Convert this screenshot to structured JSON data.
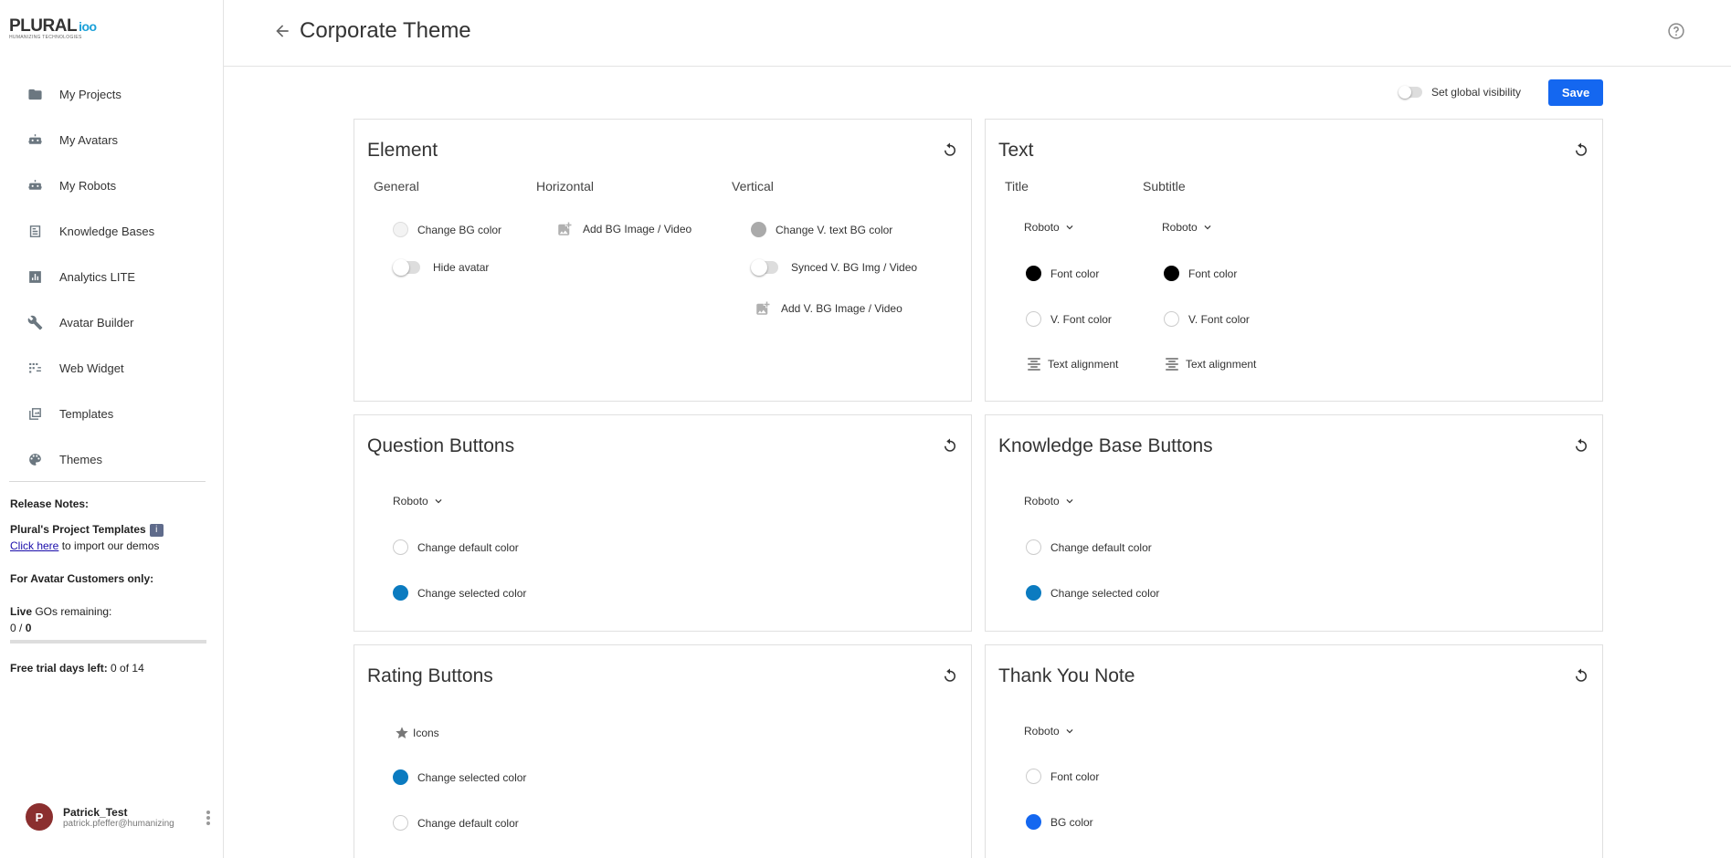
{
  "logo": {
    "word": "PLURAL",
    "mark": "ioo",
    "tagline": "HUMANIZING TECHNOLOGIES"
  },
  "nav": [
    {
      "label": "My Projects",
      "icon": "folder-icon"
    },
    {
      "label": "My Avatars",
      "icon": "robot-icon"
    },
    {
      "label": "My Robots",
      "icon": "robot-icon"
    },
    {
      "label": "Knowledge Bases",
      "icon": "book-icon"
    },
    {
      "label": "Analytics LITE",
      "icon": "chart-icon"
    },
    {
      "label": "Avatar Builder",
      "icon": "wrench-icon"
    },
    {
      "label": "Web Widget",
      "icon": "widget-icon"
    },
    {
      "label": "Templates",
      "icon": "templates-icon"
    },
    {
      "label": "Themes",
      "icon": "palette-icon"
    }
  ],
  "release": {
    "heading": "Release Notes:",
    "templates_title": "Plural's Project Templates",
    "info_glyph": "i",
    "click_here": "Click here",
    "import_text": " to import our demos",
    "avatar_customers": "For Avatar Customers only:",
    "live": "Live",
    "gos_remaining": " GOs remaining:",
    "gos_used": "0",
    "gos_sep": " / ",
    "gos_total": "0",
    "gos_progress": 0,
    "trial_label": "Free trial days left:",
    "trial_value": " 0 of 14"
  },
  "user": {
    "initial": "P",
    "name": "Patrick_Test",
    "email": "patrick.pfeffer@humanizing"
  },
  "header": {
    "title": "Corporate Theme"
  },
  "toolbar": {
    "global_visibility": "Set global visibility",
    "save": "Save"
  },
  "cards": {
    "element": {
      "title": "Element",
      "general": "General",
      "horizontal": "Horizontal",
      "vertical": "Vertical",
      "change_bg": "Change BG color",
      "hide_avatar": "Hide avatar",
      "add_bg": "Add BG Image / Video",
      "change_v_text_bg": "Change V. text BG color",
      "synced_v_bg": "Synced V. BG Img / Video",
      "add_v_bg": "Add V. BG Image / Video"
    },
    "text": {
      "title": "Text",
      "col_title": "Title",
      "col_subtitle": "Subtitle",
      "font": "Roboto",
      "font_color": "Font color",
      "v_font_color": "V. Font color",
      "text_alignment": "Text alignment"
    },
    "question": {
      "title": "Question Buttons",
      "font": "Roboto",
      "default_color": "Change default color",
      "selected_color": "Change selected color"
    },
    "kb": {
      "title": "Knowledge Base Buttons",
      "font": "Roboto",
      "default_color": "Change default color",
      "selected_color": "Change selected color"
    },
    "rating": {
      "title": "Rating Buttons",
      "icons": "Icons",
      "selected_color": "Change selected color",
      "default_color": "Change default color"
    },
    "thanks": {
      "title": "Thank You Note",
      "font": "Roboto",
      "font_color": "Font color",
      "bg_color": "BG color"
    }
  },
  "colors": {
    "accent": "#1467f0",
    "selected": "#0b7bc0",
    "avatar": "#8b2f2f"
  }
}
